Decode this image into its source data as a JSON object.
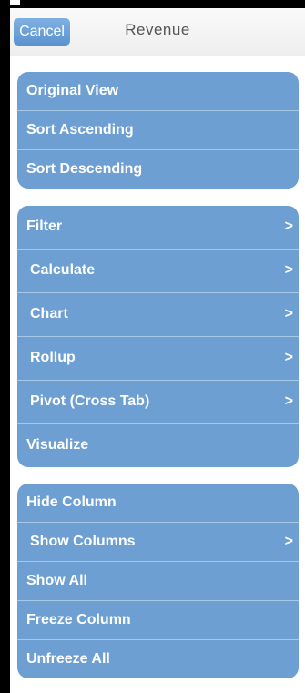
{
  "header": {
    "cancel_label": "Cancel",
    "title": "Revenue"
  },
  "groups": [
    {
      "items": [
        {
          "label": "Original View",
          "chevron": ""
        },
        {
          "label": "Sort Ascending",
          "chevron": ""
        },
        {
          "label": "Sort Descending",
          "chevron": ""
        }
      ]
    },
    {
      "items": [
        {
          "label": "Filter",
          "chevron": ">"
        },
        {
          "label": "Calculate",
          "chevron": ">"
        },
        {
          "label": "Chart",
          "chevron": ">"
        },
        {
          "label": "Rollup",
          "chevron": ">"
        },
        {
          "label": "Pivot (Cross Tab)",
          "chevron": ">"
        },
        {
          "label": "Visualize",
          "chevron": ""
        }
      ]
    },
    {
      "items": [
        {
          "label": "Hide Column",
          "chevron": ""
        },
        {
          "label": "Show Columns",
          "chevron": ">"
        },
        {
          "label": "Show All",
          "chevron": ""
        },
        {
          "label": "Freeze Column",
          "chevron": ""
        },
        {
          "label": "Unfreeze All",
          "chevron": ""
        }
      ]
    }
  ],
  "colors": {
    "accent": "#6d9fd2",
    "button": "#6b9fd6"
  }
}
